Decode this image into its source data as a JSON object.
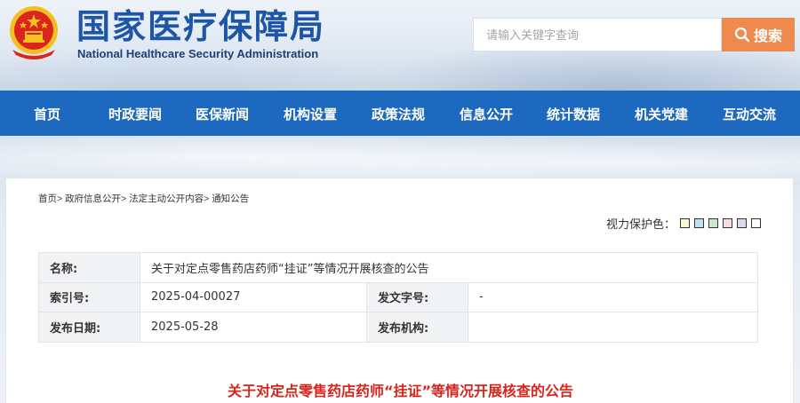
{
  "header": {
    "site_title": "国家医疗保障局",
    "site_subtitle": "National Healthcare Security Administration",
    "search_placeholder": "请输入关键字查询",
    "search_button_label": "搜索",
    "emblem_icon": "national-emblem-icon"
  },
  "nav": {
    "items": [
      "首页",
      "时政要闻",
      "医保新闻",
      "机构设置",
      "政策法规",
      "信息公开",
      "统计数据",
      "机关党建",
      "互动交流"
    ]
  },
  "breadcrumb": {
    "items": [
      "首页",
      "政府信息公开",
      "法定主动公开内容",
      "通知公告"
    ],
    "separator": ">"
  },
  "vision": {
    "label": "视力保护色：",
    "swatches": [
      "#fbf7d0",
      "#bde3f2",
      "#cfe6cf",
      "#f6dbe3",
      "#e0d6f0",
      "#ffffff"
    ]
  },
  "meta": {
    "name_label": "名称:",
    "name_value": "关于对定点零售药店药师“挂证”等情况开展核查的公告",
    "index_label": "索引号:",
    "index_value": "2025-04-00027",
    "doc_no_label": "发文字号:",
    "doc_no_value": "-",
    "date_label": "发布日期:",
    "date_value": "2025-05-28",
    "org_label": "发布机构:",
    "org_value": ""
  },
  "article": {
    "title": "关于对定点零售药店药师“挂证”等情况开展核查的公告"
  },
  "colors": {
    "nav_bg": "#1e69c0",
    "search_button": "#ef8a4e",
    "title_blue": "#1d55a8",
    "article_title_red": "#d9241c"
  }
}
